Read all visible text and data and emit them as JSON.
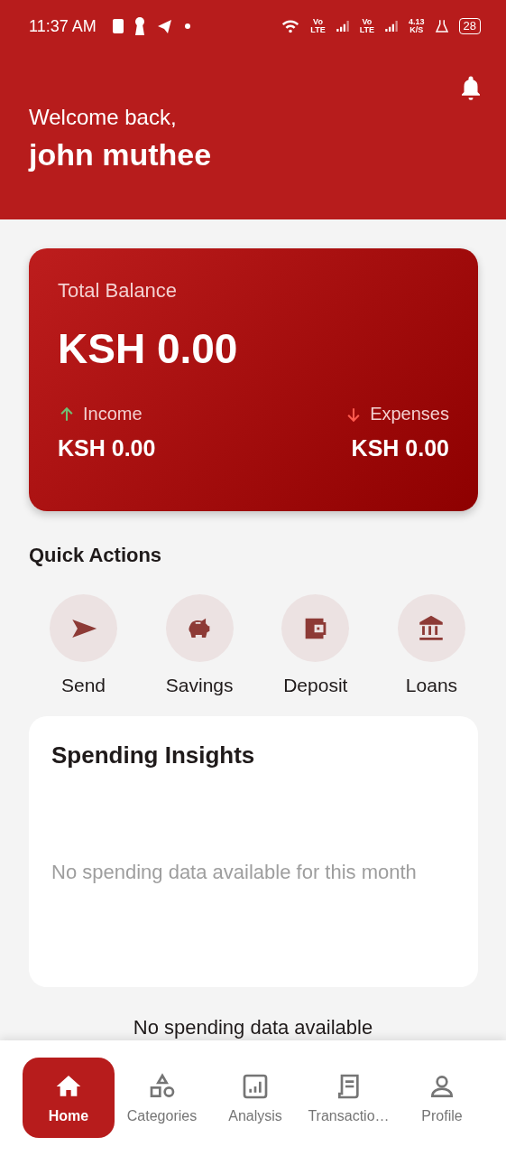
{
  "status_bar": {
    "time": "11:37 AM",
    "network_1": "Vo\nLTE",
    "network_2": "Vo\nLTE",
    "speed": "4.13\nK/S",
    "battery": "28"
  },
  "header": {
    "greeting": "Welcome back,",
    "user_name": "john muthee"
  },
  "balance_card": {
    "title": "Total Balance",
    "amount": "KSH 0.00",
    "income_label": "Income",
    "income_amount": "KSH 0.00",
    "expenses_label": "Expenses",
    "expenses_amount": "KSH 0.00"
  },
  "quick_actions": {
    "title": "Quick Actions",
    "items": [
      {
        "kind": "send",
        "label": "Send"
      },
      {
        "kind": "savings",
        "label": "Savings"
      },
      {
        "kind": "deposit",
        "label": "Deposit"
      },
      {
        "kind": "loans",
        "label": "Loans"
      }
    ]
  },
  "spending_insights": {
    "title": "Spending Insights",
    "empty_message": "No spending data available for this month"
  },
  "below_text": "No spending data available",
  "bottom_nav": [
    {
      "kind": "home",
      "label": "Home",
      "selected": true
    },
    {
      "kind": "categories",
      "label": "Categories",
      "selected": false
    },
    {
      "kind": "analysis",
      "label": "Analysis",
      "selected": false
    },
    {
      "kind": "transactions",
      "label": "Transactio…",
      "selected": false
    },
    {
      "kind": "profile",
      "label": "Profile",
      "selected": false
    }
  ]
}
